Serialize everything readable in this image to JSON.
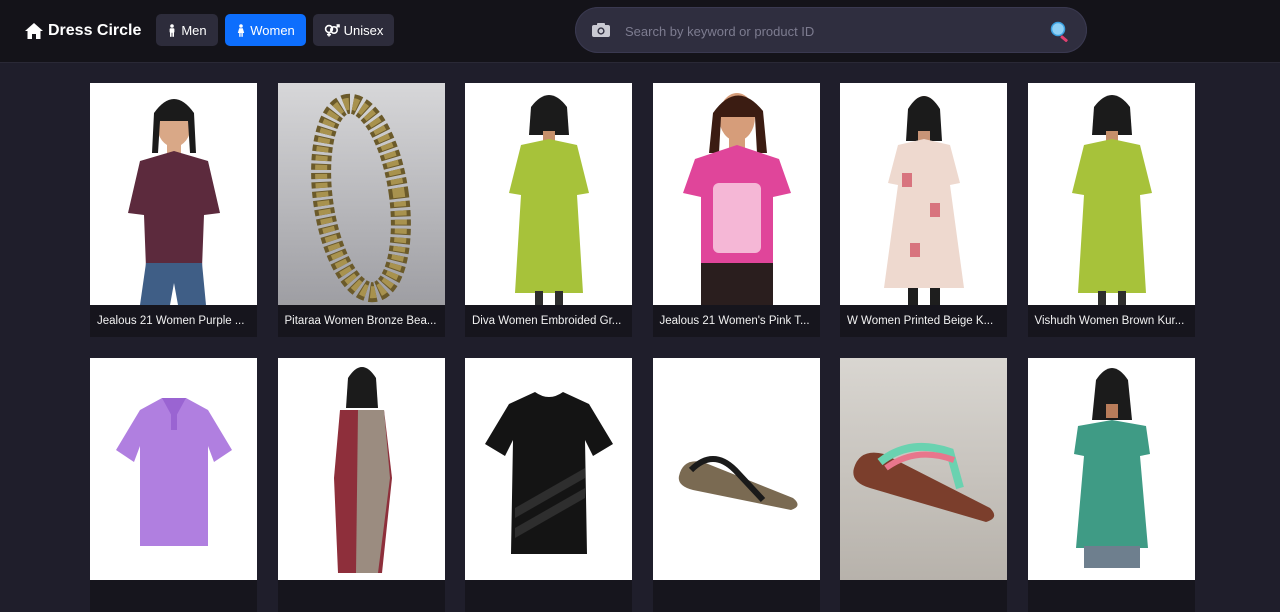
{
  "header": {
    "brand": "Dress Circle",
    "nav": [
      {
        "label": "Men",
        "active": false
      },
      {
        "label": "Women",
        "active": true
      },
      {
        "label": "Unisex",
        "active": false
      }
    ],
    "search": {
      "placeholder": "Search by keyword or product ID",
      "value": ""
    }
  },
  "colors": {
    "accent": "#0d6efd",
    "background": "#1f1e2b",
    "topbar": "#141319"
  },
  "products": [
    {
      "title": "Jealous 21 Women Purple ...",
      "icon": "person-shirt"
    },
    {
      "title": "Pitaraa Women Bronze Bea...",
      "icon": "bangle"
    },
    {
      "title": "Diva Women Embroided Gr...",
      "icon": "person-kurta"
    },
    {
      "title": "Jealous 21 Women's Pink T...",
      "icon": "person-tshirt"
    },
    {
      "title": "W Women Printed Beige K...",
      "icon": "person-dress"
    },
    {
      "title": "Vishudh Women Brown Kur...",
      "icon": "person-kurta"
    },
    {
      "title": "",
      "icon": "polo-shirt"
    },
    {
      "title": "",
      "icon": "person-saree"
    },
    {
      "title": "",
      "icon": "tshirt"
    },
    {
      "title": "",
      "icon": "sandal"
    },
    {
      "title": "",
      "icon": "flip-flop"
    },
    {
      "title": "",
      "icon": "person-top"
    }
  ]
}
